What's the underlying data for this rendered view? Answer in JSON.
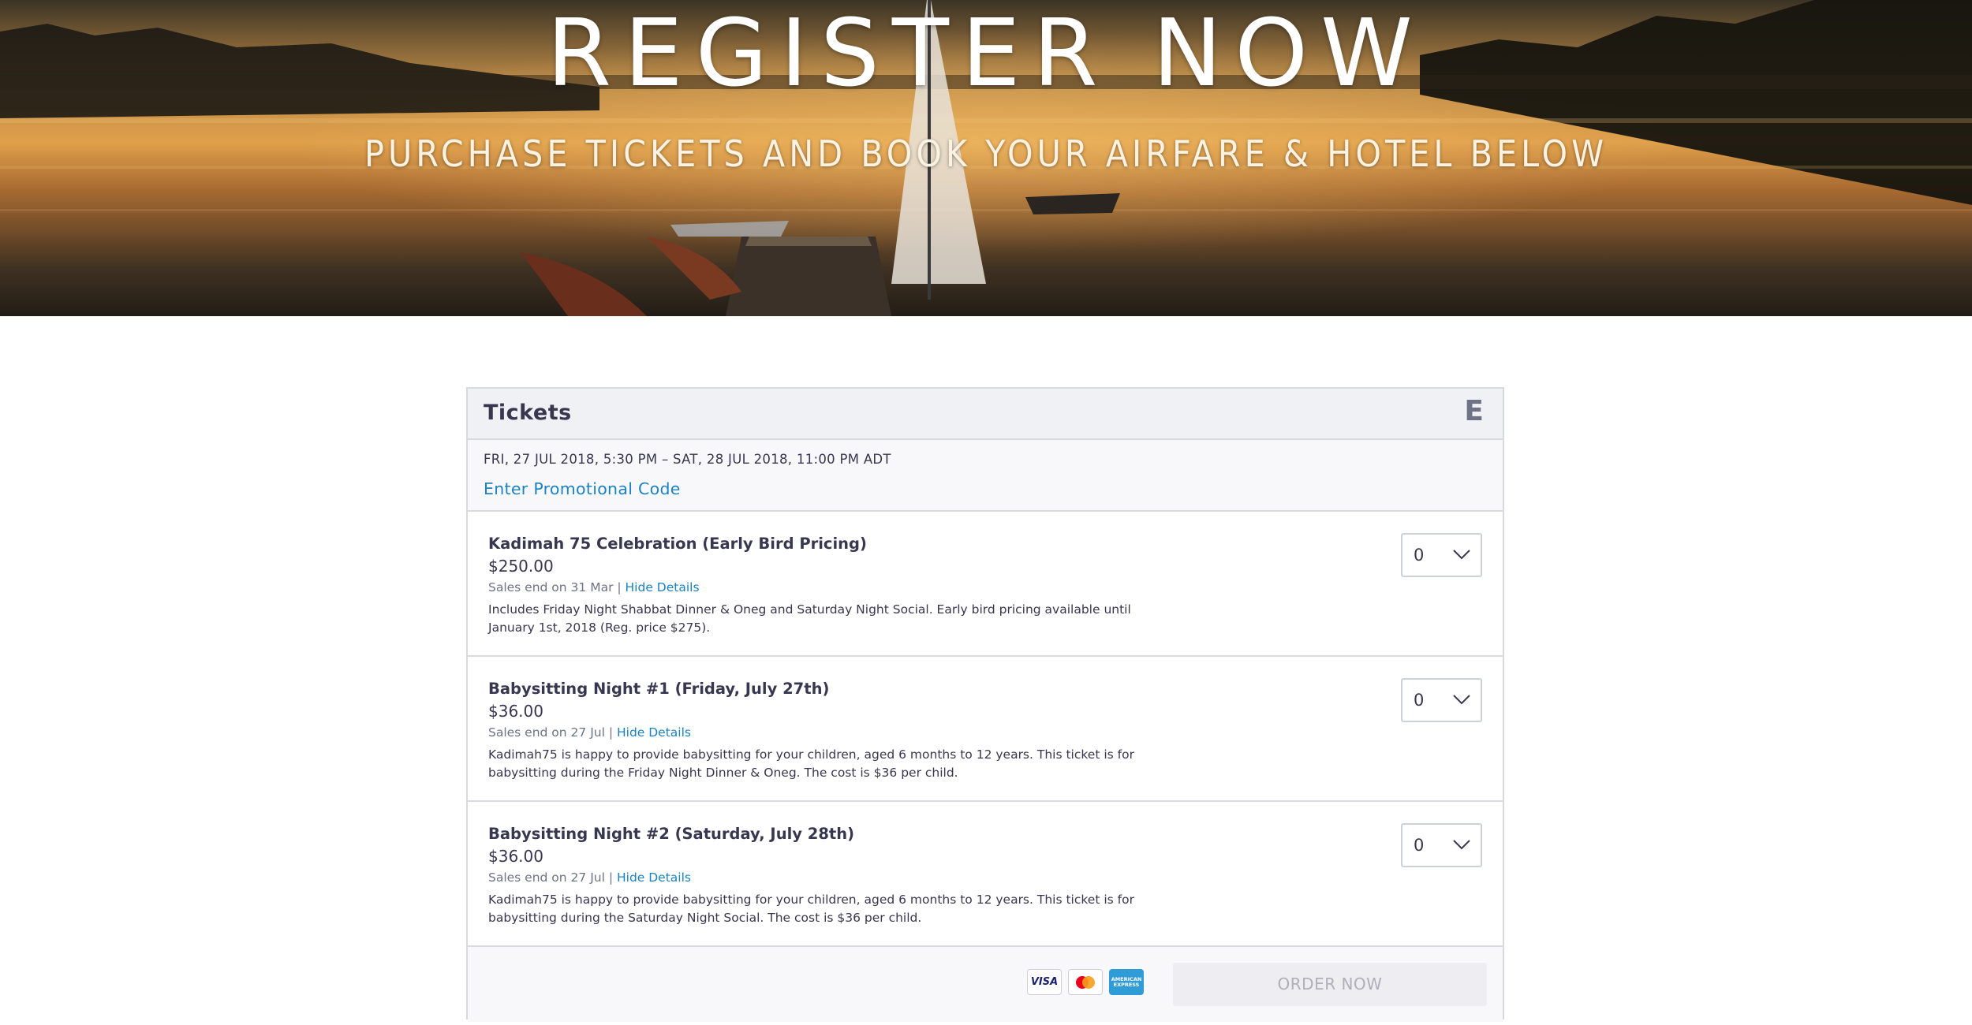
{
  "hero": {
    "title": "REGISTER NOW",
    "subtitle": "PURCHASE TICKETS AND BOOK YOUR AIRFARE & HOTEL BELOW"
  },
  "widget": {
    "title": "Tickets",
    "brand_letter": "E",
    "date_range": "FRI, 27 JUL 2018, 5:30 PM – SAT, 28 JUL 2018, 11:00 PM ADT",
    "promo_link": "Enter Promotional Code",
    "tickets": [
      {
        "name": "Kadimah 75 Celebration (Early Bird Pricing)",
        "price": "$250.00",
        "sales_end": "Sales end on 31 Mar | ",
        "details_link": "Hide Details",
        "description": "Includes Friday Night Shabbat Dinner & Oneg and Saturday Night Social. Early bird pricing available until January 1st, 2018 (Reg. price $275).",
        "quantity": "0"
      },
      {
        "name": "Babysitting Night #1 (Friday, July 27th)",
        "price": "$36.00",
        "sales_end": "Sales end on 27 Jul | ",
        "details_link": "Hide Details",
        "description": "Kadimah75 is happy to provide babysitting for your children, aged 6 months to 12 years. This ticket is for babysitting during the Friday Night Dinner & Oneg. The cost is $36 per child.",
        "quantity": "0"
      },
      {
        "name": "Babysitting Night #2 (Saturday, July 28th)",
        "price": "$36.00",
        "sales_end": "Sales end on 27 Jul | ",
        "details_link": "Hide Details",
        "description": "Kadimah75 is happy to provide babysitting for your children, aged 6 months to 12 years. This ticket is for babysitting during the Saturday Night Social. The cost is $36 per child.",
        "quantity": "0"
      }
    ],
    "payment_cards": {
      "visa": "VISA",
      "mastercard": "mastercard-icon",
      "amex": "AMERICAN EXPRESS"
    },
    "order_button": "ORDER NOW"
  },
  "colors": {
    "link": "#1b82c3",
    "text": "#39364f",
    "border": "#d7d9df",
    "button_disabled_bg": "#eeedf2"
  }
}
